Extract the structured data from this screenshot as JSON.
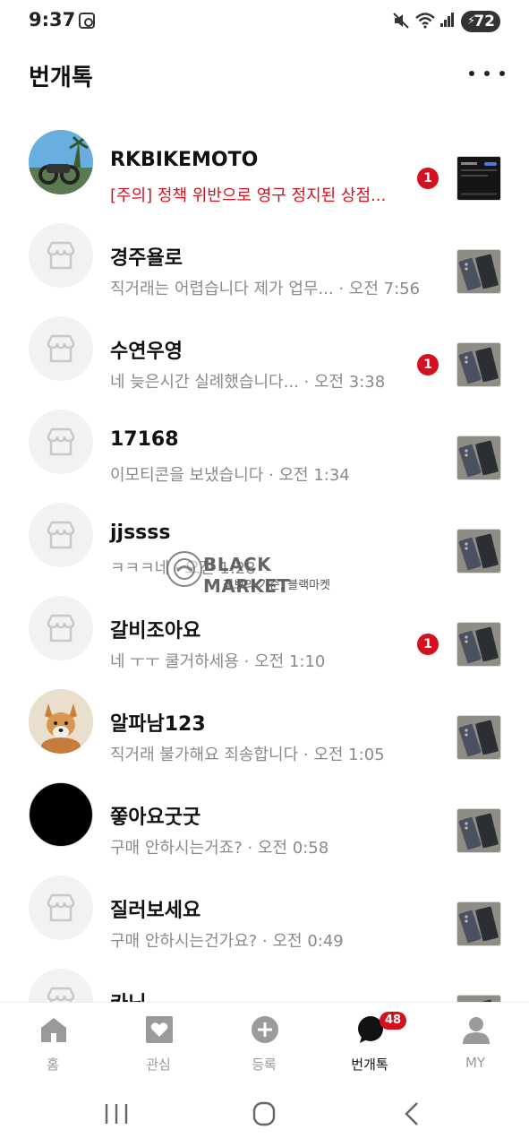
{
  "status_bar": {
    "time": "9:37",
    "battery": "72"
  },
  "header": {
    "title": "번개톡"
  },
  "chats": [
    {
      "name": "RKBIKEMOTO",
      "preview": "[주의] 정책 위반으로 영구 정지된 상점...",
      "time": "",
      "unread": "1",
      "avatar": "photo-motorcycle",
      "warning": true
    },
    {
      "name": "경주욜로",
      "preview": "직거래는 어렵습니다 제가 업무...",
      "time": " · 오전 7:56",
      "unread": "",
      "avatar": "store-icon"
    },
    {
      "name": "수연우영",
      "preview": "네 늦은시간 실례했습니다...",
      "time": " · 오전 3:38",
      "unread": "1",
      "avatar": "store-icon"
    },
    {
      "name": "17168",
      "preview": "이모티콘을 보냈습니다",
      "time": " · 오전 1:34",
      "unread": "",
      "avatar": "store-icon"
    },
    {
      "name": "jjssss",
      "preview": "ㅋㅋㅋ네",
      "time": " · 오전 1:28",
      "unread": "",
      "avatar": "store-icon"
    },
    {
      "name": "갈비조아요",
      "preview": "네 ㅜㅜ 쿨거하세용",
      "time": " · 오전 1:10",
      "unread": "1",
      "avatar": "store-icon"
    },
    {
      "name": "알파남123",
      "preview": "직거래 불가해요 죄송합니다",
      "time": " · 오전 1:05",
      "unread": "",
      "avatar": "photo-dog"
    },
    {
      "name": "쫗아요굿굿",
      "preview": "구매 안하시는거죠?",
      "time": " · 오전 0:58",
      "unread": "",
      "avatar": "black-circle"
    },
    {
      "name": "질러보세요",
      "preview": "구매 안하시는건가요?",
      "time": " · 오전 0:49",
      "unread": "",
      "avatar": "store-icon"
    },
    {
      "name": "카닌",
      "preview": "",
      "time": "",
      "unread": "",
      "avatar": "store-icon"
    }
  ],
  "watermark": {
    "logo_text": "BLACK MARKET",
    "title": "BLACK MARKET",
    "subtitle": "정보의 기준, 블랙마켓"
  },
  "bottom_nav": {
    "items": [
      {
        "label": "홈",
        "icon": "home-icon"
      },
      {
        "label": "관심",
        "icon": "heart-icon"
      },
      {
        "label": "등록",
        "icon": "plus-icon"
      },
      {
        "label": "번개톡",
        "icon": "chat-icon",
        "badge": "48",
        "active": true
      },
      {
        "label": "MY",
        "icon": "person-icon"
      }
    ]
  },
  "colors": {
    "accent_red": "#d4111e",
    "muted_text": "#8a8a8a"
  }
}
